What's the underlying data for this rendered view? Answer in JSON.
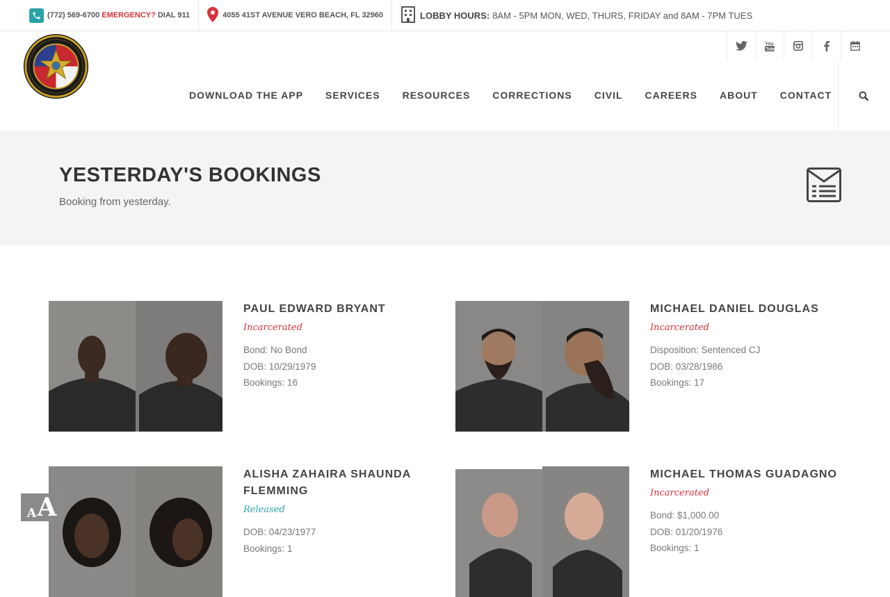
{
  "topbar": {
    "phone": "(772) 569-6700",
    "emergency": "EMERGENCY?",
    "dial": "DIAL 911",
    "address": "4055 41ST AVENUE VERO BEACH, FL 32960",
    "lobby_label": "LOBBY HOURS:",
    "lobby_hours": "8AM - 5PM MON, WED, THURS, FRIDAY and 8AM - 7PM TUES"
  },
  "header": {
    "social": [
      "twitter-icon",
      "youtube-icon",
      "instagram-icon",
      "facebook-icon",
      "calendar-icon"
    ],
    "nav": [
      "DOWNLOAD THE APP",
      "SERVICES",
      "RESOURCES",
      "CORRECTIONS",
      "CIVIL",
      "CAREERS",
      "ABOUT",
      "CONTACT"
    ]
  },
  "page": {
    "title": "YESTERDAY'S BOOKINGS",
    "subtitle": "Booking from yesterday."
  },
  "bookings": [
    {
      "name": "PAUL EDWARD BRYANT",
      "status": "Incarcerated",
      "status_color": "#d9303b",
      "lines": [
        "Bond: No Bond",
        "DOB: 10/29/1979",
        "Bookings: 16"
      ]
    },
    {
      "name": "MICHAEL DANIEL DOUGLAS",
      "status": "Incarcerated",
      "status_color": "#d9303b",
      "lines": [
        "Disposition: Sentenced CJ",
        "DOB: 03/28/1986",
        "Bookings: 17"
      ]
    },
    {
      "name": "ALISHA ZAHAIRA SHAUNDA FLEMMING",
      "status": "Released",
      "status_color": "#2aa3a8",
      "lines": [
        "DOB: 04/23/1977",
        "Bookings: 1"
      ]
    },
    {
      "name": "MICHAEL THOMAS GUADAGNO",
      "status": "Incarcerated",
      "status_color": "#d9303b",
      "lines": [
        "Bond: $1,000.00",
        "DOB: 01/20/1976",
        "Bookings: 1"
      ]
    }
  ],
  "accessibility": {
    "small": "A",
    "big": "A"
  }
}
